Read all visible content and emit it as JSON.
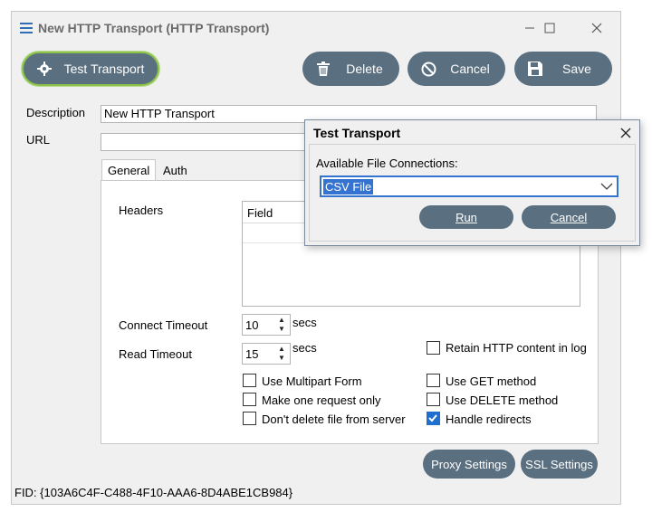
{
  "window": {
    "title": "New HTTP Transport (HTTP Transport)",
    "icon": "hamburger-icon",
    "controls": [
      "minimize-icon",
      "maximize-icon",
      "close-icon"
    ]
  },
  "toolbar": {
    "test_transport_label": "Test Transport",
    "delete_label": "Delete",
    "cancel_label": "Cancel",
    "save_label": "Save"
  },
  "form": {
    "description_label": "Description",
    "description_value": "New HTTP Transport",
    "url_label": "URL",
    "url_value": ""
  },
  "tabs": [
    {
      "label": "General",
      "active": true
    },
    {
      "label": "Auth",
      "active": false
    }
  ],
  "general": {
    "headers_label": "Headers",
    "headers_column": "Field",
    "connect_timeout_label": "Connect Timeout",
    "connect_timeout_value": "10",
    "read_timeout_label": "Read Timeout",
    "read_timeout_value": "15",
    "secs_label": "secs",
    "checkboxes": {
      "retain_http": {
        "label": "Retain HTTP content in log",
        "checked": false
      },
      "use_multipart": {
        "label": "Use Multipart Form",
        "checked": false
      },
      "use_get": {
        "label": "Use GET method",
        "checked": false
      },
      "one_request": {
        "label": "Make one request only",
        "checked": false
      },
      "use_delete": {
        "label": "Use DELETE method",
        "checked": false
      },
      "dont_delete": {
        "label": "Don't delete file from server",
        "checked": false
      },
      "handle_redirects": {
        "label": "Handle redirects",
        "checked": true
      }
    },
    "proxy_settings_label": "Proxy Settings",
    "ssl_settings_label": "SSL Settings"
  },
  "footer": {
    "fid": "FID: {103A6C4F-C488-4F10-AAA6-8D4ABE1CB984}"
  },
  "dialog": {
    "title": "Test Transport",
    "prompt": "Available File Connections:",
    "selected": "CSV File",
    "run_label": "Run",
    "cancel_label": "Cancel"
  },
  "colors": {
    "button_bg": "#5a6f80",
    "accent_green": "#8bc34a",
    "select_highlight": "#3573d1",
    "check_blue": "#1f6fd0"
  }
}
